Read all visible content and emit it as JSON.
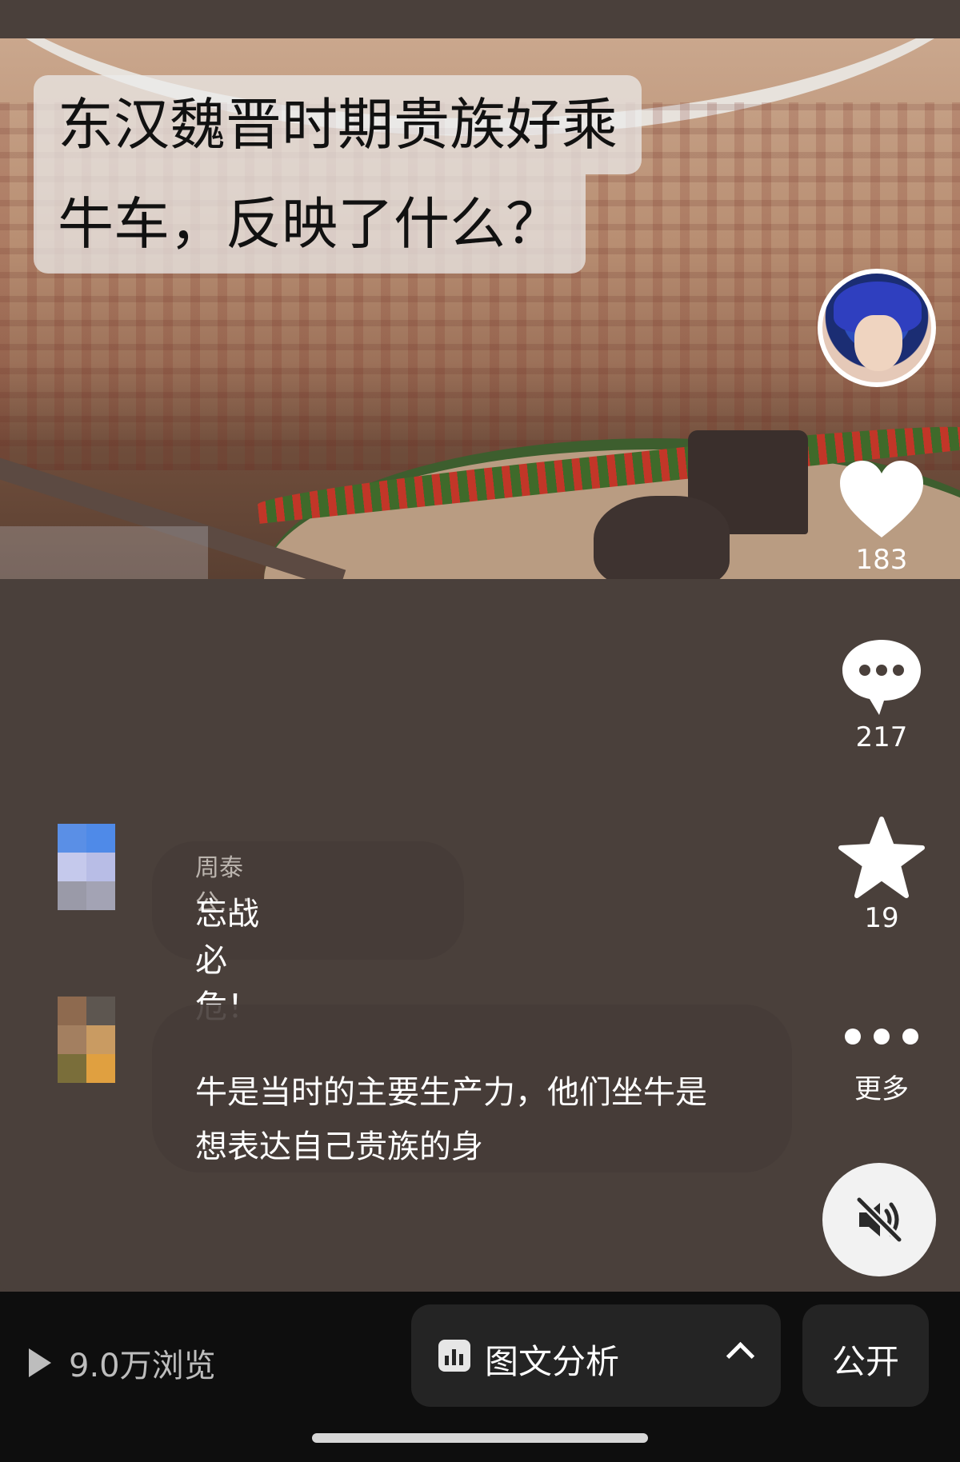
{
  "caption": {
    "line1": "东汉魏晋时期贵族好乘",
    "line2": "牛车，反映了什么？"
  },
  "actions": {
    "like_count": "183",
    "comment_count": "217",
    "favorite_count": "19",
    "more_label": "更多"
  },
  "comments": [
    {
      "name": "周泰公...:",
      "text": "忘战必危！"
    },
    {
      "name": "",
      "text": "牛是当时的主要生产力，他们坐牛是想表达自己贵族的身"
    }
  ],
  "bottom": {
    "views": "9.0万浏览",
    "analysis_label": "图文分析",
    "public_label": "公开"
  },
  "icons": {
    "play": "play-icon",
    "like": "heart-icon",
    "comment": "chat-bubble-icon",
    "favorite": "star-icon",
    "more": "more-dots-icon",
    "mute": "speaker-muted-icon",
    "analysis": "chart-icon",
    "expand": "chevron-up-icon"
  },
  "colors": {
    "bar_bg": "#0e0e0e",
    "page_bg": "#4a403b",
    "button_bg": "#242424"
  }
}
